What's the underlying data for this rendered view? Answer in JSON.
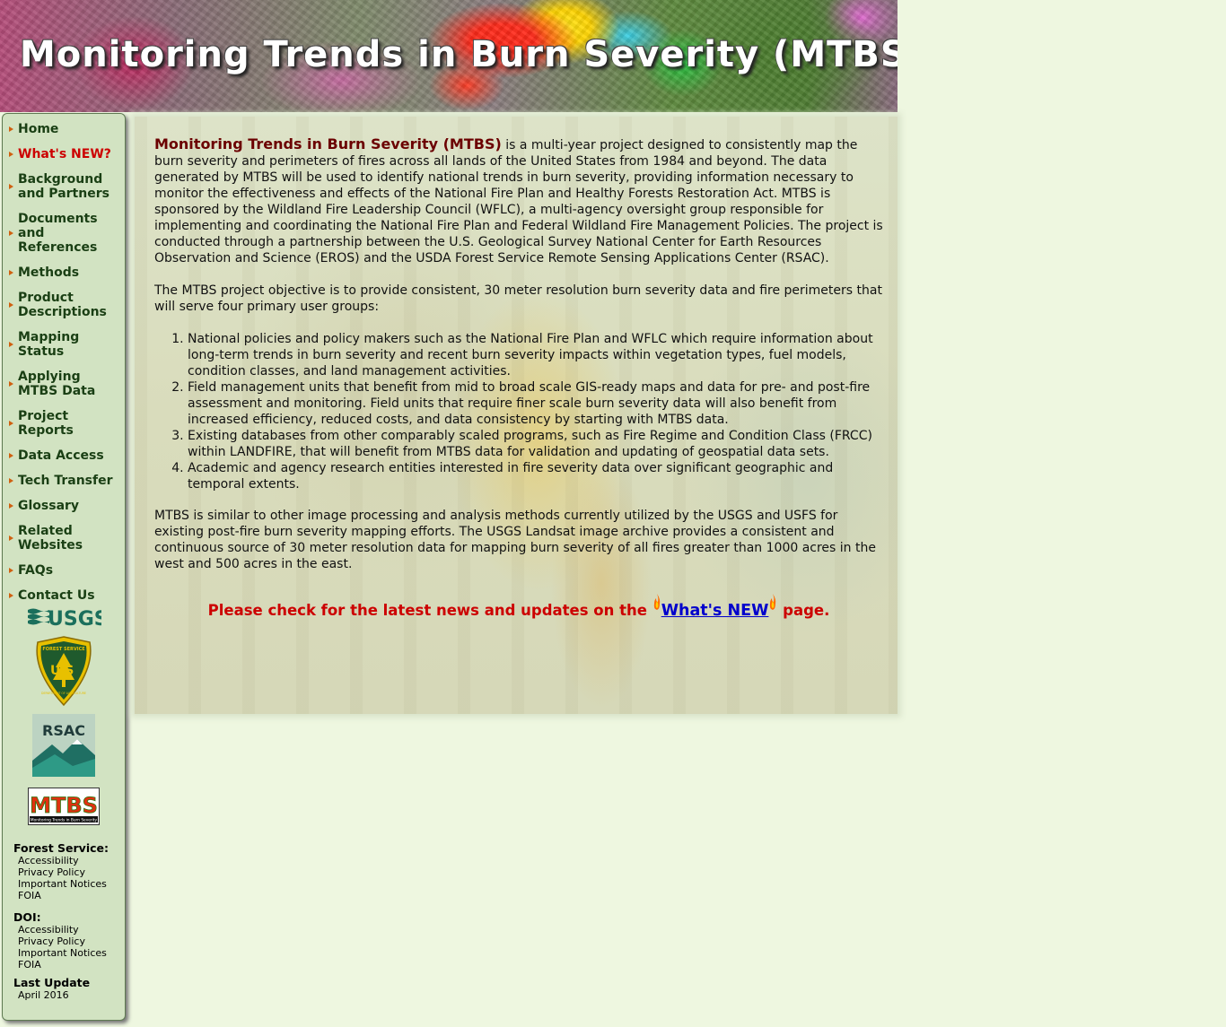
{
  "banner": {
    "title": "Monitoring Trends in Burn Severity (MTBS)"
  },
  "nav": {
    "items": [
      {
        "label": "Home"
      },
      {
        "label": "What's NEW?"
      },
      {
        "label": "Background and Partners"
      },
      {
        "label": "Documents and References"
      },
      {
        "label": "Methods"
      },
      {
        "label": "Product Descriptions"
      },
      {
        "label": "Mapping Status"
      },
      {
        "label": "Applying MTBS Data"
      },
      {
        "label": "Project Reports"
      },
      {
        "label": "Data Access"
      },
      {
        "label": "Tech Transfer"
      },
      {
        "label": "Glossary"
      },
      {
        "label": "Related Websites"
      },
      {
        "label": "FAQs"
      },
      {
        "label": "Contact Us"
      }
    ],
    "accent_color": "#c00000",
    "bullet_color": "#d06010"
  },
  "logos": {
    "usgs": "USGS",
    "forest_service_text": "FOREST SERVICE",
    "forest_service_letters": "U S",
    "forest_service_bottom": "DEPARTMENT OF AGRICULTURE",
    "rsac": "RSAC",
    "mtbs": "MTBS",
    "mtbs_sub": "Monitoring Trends in Burn Severity"
  },
  "footer": {
    "forest_service_heading": "Forest Service:",
    "forest_service_links": [
      "Accessibility",
      "Privacy Policy",
      "Important Notices",
      "FOIA"
    ],
    "doi_heading": "DOI:",
    "doi_links": [
      "Accessibility",
      "Privacy Policy",
      "Important Notices",
      "FOIA"
    ],
    "last_update_heading": "Last Update",
    "last_update_value": "April 2016"
  },
  "main": {
    "intro_title": "Monitoring Trends in Burn Severity (MTBS)",
    "intro_text": " is a multi-year project designed to consistently map the burn severity and perimeters of fires across all lands of the United States from 1984 and beyond. The data generated by MTBS will be used to identify national trends in burn severity, providing information necessary to monitor the effectiveness and effects of the National Fire Plan and Healthy Forests Restoration Act. MTBS is sponsored by the Wildland Fire Leadership Council (WFLC), a multi-agency oversight group responsible for implementing and coordinating the National Fire Plan and Federal Wildland Fire Management Policies. The project is conducted through a partnership between the U.S. Geological Survey National Center for Earth Resources Observation and Science (EROS) and the USDA Forest Service Remote Sensing Applications Center (RSAC).",
    "objective_text": "The MTBS project objective is to provide consistent, 30 meter resolution burn severity data and fire perimeters that will serve four primary user groups:",
    "user_groups": [
      "National policies and policy makers such as the National Fire Plan and WFLC which require information about long-term trends in burn severity and recent burn severity impacts within vegetation types, fuel models, condition classes, and land management activities.",
      "Field management units that benefit from mid to broad scale GIS-ready maps and data for pre- and post-fire assessment and monitoring. Field units that require finer scale burn severity data will also benefit from increased efficiency, reduced costs, and data consistency by starting with MTBS data.",
      "Existing databases from other comparably scaled programs, such as Fire Regime and Condition Class (FRCC) within LANDFIRE, that will benefit from MTBS data for validation and updating of geospatial data sets.",
      "Academic and agency research entities interested in fire severity data over significant geographic and temporal extents."
    ],
    "similar_text": "MTBS is similar to other image processing and analysis methods currently utilized by the USGS and USFS for existing post-fire burn severity mapping efforts. The USGS Landsat image archive provides a consistent and continuous source of 30 meter resolution data for mapping burn severity of all fires greater than 1000 acres in the west and 500 acres in the east.",
    "news_prefix": "Please check for the latest news and updates on the ",
    "news_link": "What's NEW",
    "news_suffix": " page."
  }
}
